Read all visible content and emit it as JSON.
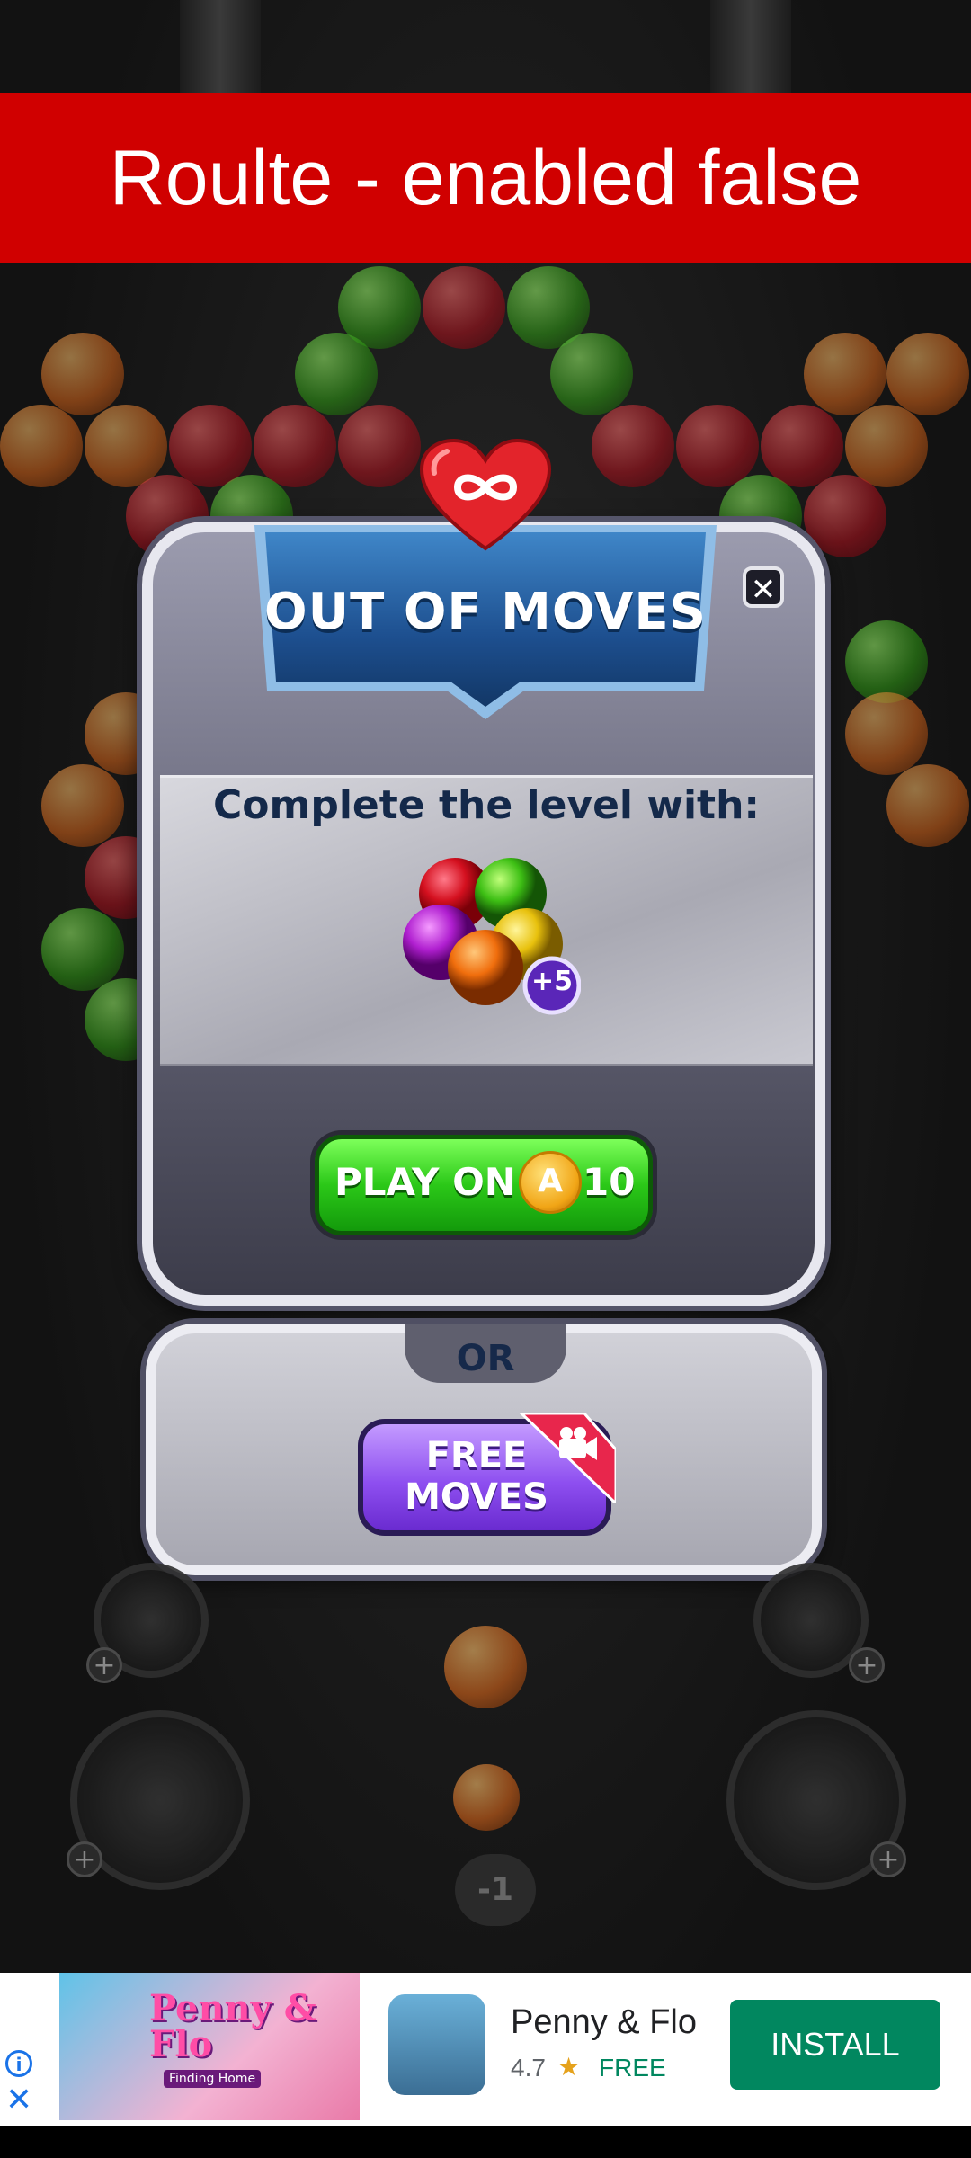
{
  "debug_banner": {
    "text": "Roulte - enabled false"
  },
  "dialog": {
    "title": "OUT OF MOVES",
    "close_icon": "close-icon",
    "subtitle": "Complete the level with:",
    "bonus_badge": "+5",
    "play_on": {
      "label": "PLAY ON",
      "cost": "10",
      "coin_symbol": "A"
    },
    "or_label": "OR",
    "free_moves": {
      "label_line1": "FREE",
      "label_line2": "MOVES",
      "icon": "video-camera-icon"
    }
  },
  "game": {
    "shots_indicator": "-1"
  },
  "ad": {
    "app_name": "Penny & Flo",
    "banner_title": "Penny & Flo",
    "banner_subtitle": "Finding Home",
    "rating": "4.7",
    "price": "FREE",
    "install_label": "INSTALL",
    "info_icon": "info-icon",
    "close_icon": "close-icon"
  },
  "colors": {
    "banner": "#d00000",
    "play_button": "#2bc818",
    "free_moves_button": "#8e4ff0",
    "install_button": "#01875f"
  }
}
